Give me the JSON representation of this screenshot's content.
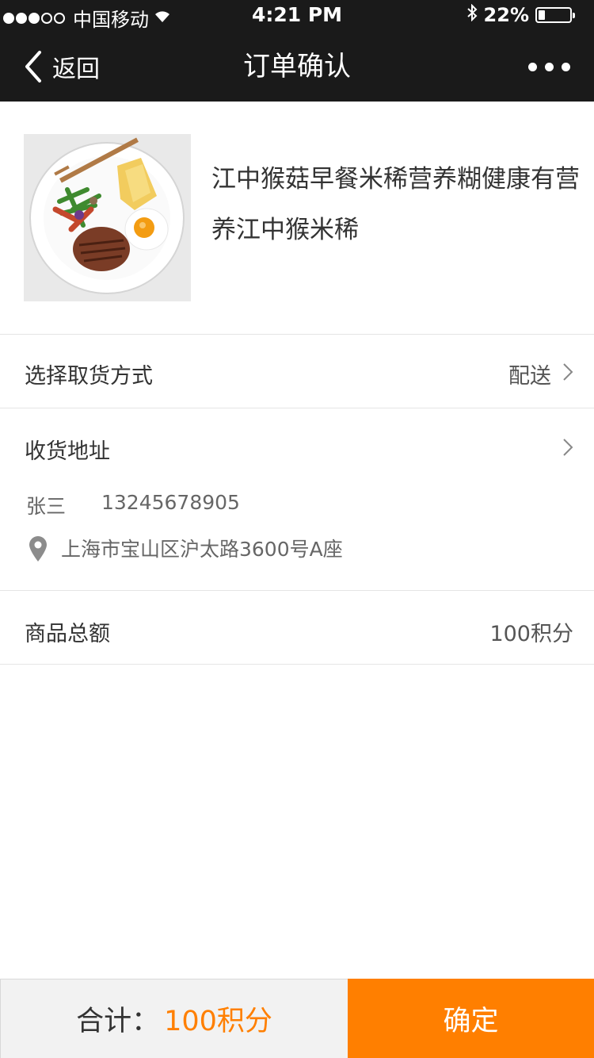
{
  "status_bar": {
    "carrier": "中国移动",
    "time": "4:21 PM",
    "battery_percent": "22%",
    "battery_level": 0.22
  },
  "nav": {
    "back_label": "返回",
    "title": "订单确认"
  },
  "product": {
    "name": "江中猴菇早餐米稀营养糊健康有营养江中猴米稀"
  },
  "delivery": {
    "label": "选择取货方式",
    "value": "配送"
  },
  "address": {
    "label": "收货地址",
    "receiver": "张三",
    "phone": "13245678905",
    "address": "上海市宝山区沪太路3600号A座"
  },
  "total": {
    "label": "商品总额",
    "value": "100积分"
  },
  "bottom_bar": {
    "sum_label": "合计：",
    "sum_value": "100积分",
    "confirm_label": "确定"
  },
  "colors": {
    "accent": "#ff7f00",
    "header_bg": "#1a1a1a"
  }
}
